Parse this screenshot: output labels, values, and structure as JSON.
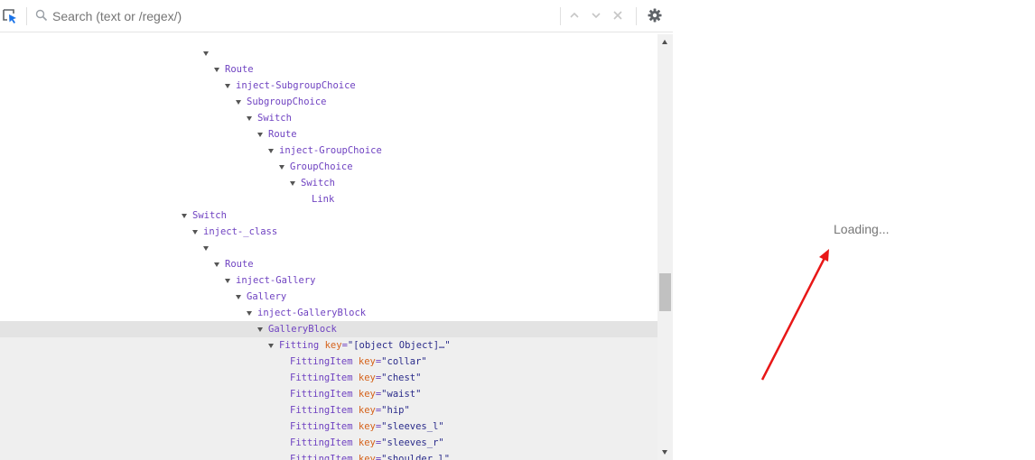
{
  "toolbar": {
    "search_placeholder": "Search (text or /regex/)",
    "inspect_icon": "select-element-icon",
    "search_icon": "magnifier-icon",
    "prev_icon": "chevron-up-icon",
    "next_icon": "chevron-down-icon",
    "clear_icon": "close-icon",
    "settings_icon": "gear-icon"
  },
  "tree": [
    {
      "caret": false,
      "name": "",
      "attrs": []
    },
    {
      "caret": true,
      "name": "",
      "attrs": []
    },
    {
      "caret": true,
      "name": "Route",
      "attrs": []
    },
    {
      "caret": true,
      "name": "inject-SubgroupChoice",
      "attrs": []
    },
    {
      "caret": true,
      "name": "SubgroupChoice",
      "attrs": []
    },
    {
      "caret": true,
      "name": "Switch",
      "attrs": []
    },
    {
      "caret": true,
      "name": "Route",
      "attrs": []
    },
    {
      "caret": true,
      "name": "inject-GroupChoice",
      "attrs": []
    },
    {
      "caret": true,
      "name": "GroupChoice",
      "attrs": []
    },
    {
      "caret": true,
      "name": "Switch",
      "attrs": []
    },
    {
      "caret": false,
      "name": "Link",
      "attrs": []
    },
    {
      "caret": true,
      "name": "Switch",
      "attrs": []
    },
    {
      "caret": true,
      "name": "inject-_class",
      "attrs": []
    },
    {
      "caret": true,
      "name": "",
      "attrs": []
    },
    {
      "caret": true,
      "name": "Route",
      "attrs": []
    },
    {
      "caret": true,
      "name": "inject-Gallery",
      "attrs": []
    },
    {
      "caret": true,
      "name": "Gallery",
      "attrs": []
    },
    {
      "caret": true,
      "name": "inject-GalleryBlock",
      "attrs": []
    },
    {
      "caret": true,
      "name": "GalleryBlock",
      "attrs": [],
      "state": "selected"
    },
    {
      "caret": true,
      "name": "Fitting",
      "attrs": [
        {
          "key": "key",
          "value": "\"[object Object]…\""
        }
      ],
      "state": "branch"
    },
    {
      "caret": false,
      "name": "FittingItem",
      "attrs": [
        {
          "key": "key",
          "value": "\"collar\""
        }
      ],
      "state": "branch"
    },
    {
      "caret": false,
      "name": "FittingItem",
      "attrs": [
        {
          "key": "key",
          "value": "\"chest\""
        }
      ],
      "state": "branch"
    },
    {
      "caret": false,
      "name": "FittingItem",
      "attrs": [
        {
          "key": "key",
          "value": "\"waist\""
        }
      ],
      "state": "branch"
    },
    {
      "caret": false,
      "name": "FittingItem",
      "attrs": [
        {
          "key": "key",
          "value": "\"hip\""
        }
      ],
      "state": "branch"
    },
    {
      "caret": false,
      "name": "FittingItem",
      "attrs": [
        {
          "key": "key",
          "value": "\"sleeves_l\""
        }
      ],
      "state": "branch"
    },
    {
      "caret": false,
      "name": "FittingItem",
      "attrs": [
        {
          "key": "key",
          "value": "\"sleeves_r\""
        }
      ],
      "state": "branch"
    },
    {
      "caret": false,
      "name": "FittingItem",
      "attrs": [
        {
          "key": "key",
          "value": "\"shoulder_l\""
        }
      ],
      "state": "branch"
    }
  ],
  "preview": {
    "loading_text": "Loading..."
  },
  "annotation": {
    "arrow_color": "#e81717"
  }
}
